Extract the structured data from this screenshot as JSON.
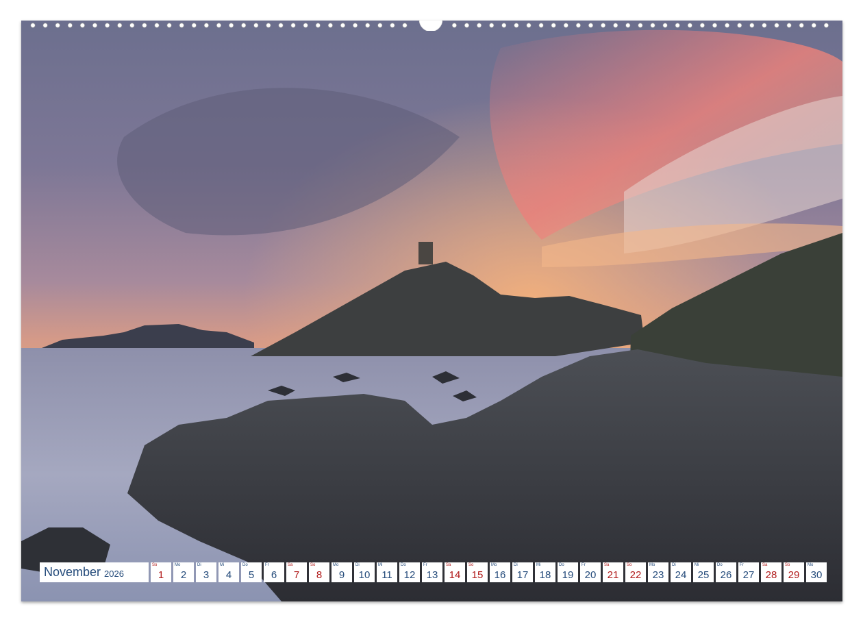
{
  "colors": {
    "weekday_text": "#234a7a",
    "weekend_text": "#b01818",
    "page_background": "#ffffff"
  },
  "photo": {
    "subject": "coastal-sunset-tower-on-hill"
  },
  "calendar": {
    "month": "November",
    "year": "2026",
    "days": [
      {
        "wd": "So",
        "num": "1",
        "weekend": true
      },
      {
        "wd": "Mo",
        "num": "2",
        "weekend": false
      },
      {
        "wd": "Di",
        "num": "3",
        "weekend": false
      },
      {
        "wd": "Mi",
        "num": "4",
        "weekend": false
      },
      {
        "wd": "Do",
        "num": "5",
        "weekend": false
      },
      {
        "wd": "Fr",
        "num": "6",
        "weekend": false
      },
      {
        "wd": "Sa",
        "num": "7",
        "weekend": true
      },
      {
        "wd": "So",
        "num": "8",
        "weekend": true
      },
      {
        "wd": "Mo",
        "num": "9",
        "weekend": false
      },
      {
        "wd": "Di",
        "num": "10",
        "weekend": false
      },
      {
        "wd": "Mi",
        "num": "11",
        "weekend": false
      },
      {
        "wd": "Do",
        "num": "12",
        "weekend": false
      },
      {
        "wd": "Fr",
        "num": "13",
        "weekend": false
      },
      {
        "wd": "Sa",
        "num": "14",
        "weekend": true
      },
      {
        "wd": "So",
        "num": "15",
        "weekend": true
      },
      {
        "wd": "Mo",
        "num": "16",
        "weekend": false
      },
      {
        "wd": "Di",
        "num": "17",
        "weekend": false
      },
      {
        "wd": "Mi",
        "num": "18",
        "weekend": false
      },
      {
        "wd": "Do",
        "num": "19",
        "weekend": false
      },
      {
        "wd": "Fr",
        "num": "20",
        "weekend": false
      },
      {
        "wd": "Sa",
        "num": "21",
        "weekend": true
      },
      {
        "wd": "So",
        "num": "22",
        "weekend": true
      },
      {
        "wd": "Mo",
        "num": "23",
        "weekend": false
      },
      {
        "wd": "Di",
        "num": "24",
        "weekend": false
      },
      {
        "wd": "Mi",
        "num": "25",
        "weekend": false
      },
      {
        "wd": "Do",
        "num": "26",
        "weekend": false
      },
      {
        "wd": "Fr",
        "num": "27",
        "weekend": false
      },
      {
        "wd": "Sa",
        "num": "28",
        "weekend": true
      },
      {
        "wd": "So",
        "num": "29",
        "weekend": true
      },
      {
        "wd": "Mo",
        "num": "30",
        "weekend": false
      }
    ]
  }
}
